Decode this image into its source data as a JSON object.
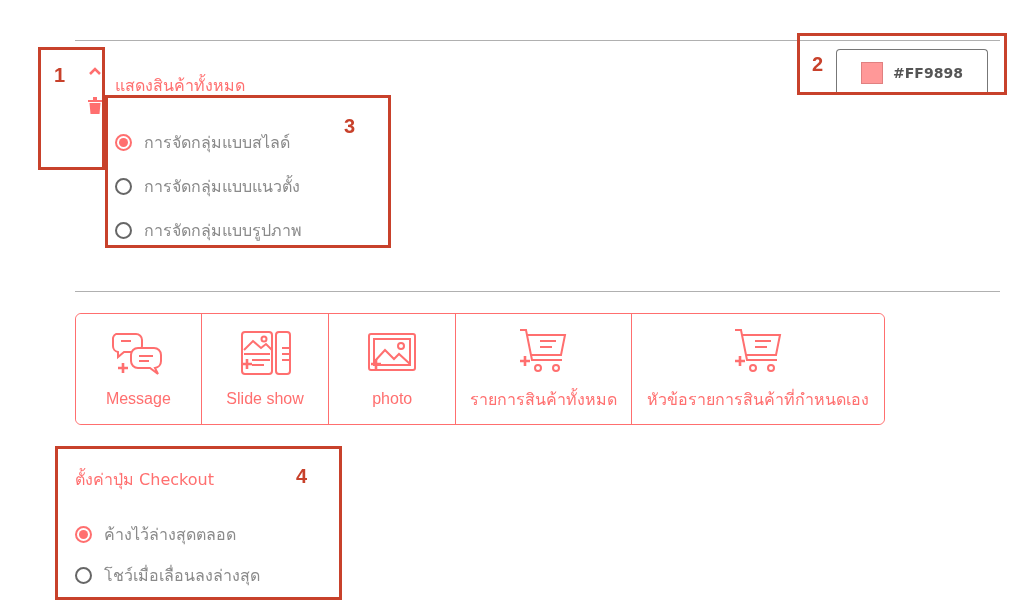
{
  "display_section": {
    "title": "แสดงสินค้าทั้งหมด",
    "color_value": "#FF9898",
    "color": "#ff9898",
    "options": [
      {
        "label": "การจัดกลุ่มแบบสไลด์",
        "selected": true
      },
      {
        "label": "การจัดกลุ่มแบบแนวตั้ง",
        "selected": false
      },
      {
        "label": "การจัดกลุ่มแบบรูปภาพ",
        "selected": false
      }
    ]
  },
  "toolbar": [
    {
      "label": "Message",
      "kind": "message"
    },
    {
      "label": "Slide show",
      "kind": "slideshow"
    },
    {
      "label": "photo",
      "kind": "photo"
    },
    {
      "label": "รายการสินค้าทั้งหมด",
      "kind": "cart"
    },
    {
      "label": "หัวข้อรายการสินค้าที่กำหนดเอง",
      "kind": "cart"
    }
  ],
  "checkout_section": {
    "title": "ตั้งค่าปุ่ม Checkout",
    "options": [
      {
        "label": "ค้างไว้ล่างสุดตลอด",
        "selected": true
      },
      {
        "label": "โชว์เมื่อเลื่อนลงล่างสุด",
        "selected": false
      }
    ]
  },
  "callouts": [
    "1",
    "2",
    "3",
    "4"
  ]
}
